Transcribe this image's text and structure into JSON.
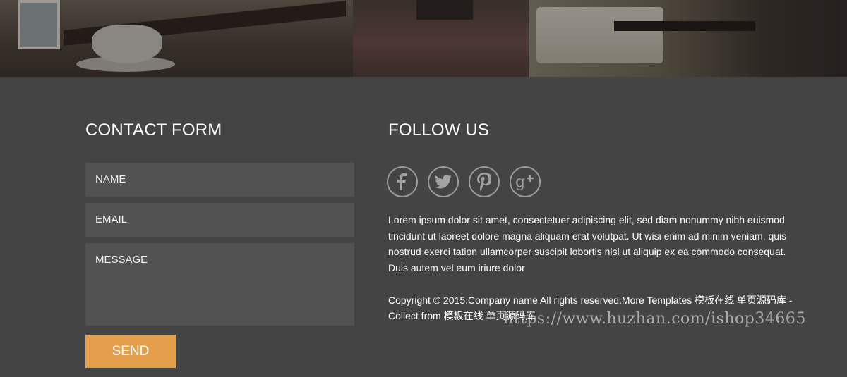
{
  "contact_form": {
    "title": "CONTACT FORM",
    "name_placeholder": "NAME",
    "email_placeholder": "EMAIL",
    "message_placeholder": "MESSAGE",
    "send_label": "SEND"
  },
  "follow": {
    "title": "FOLLOW US",
    "icons": [
      "facebook-icon",
      "twitter-icon",
      "pinterest-icon",
      "google-plus-icon"
    ],
    "description": "Lorem ipsum dolor sit amet, consectetuer adipiscing elit, sed diam nonummy nibh euismod tincidunt ut laoreet dolore magna aliquam erat volutpat. Ut wisi enim ad minim veniam, quis nostrud exerci tation ullamcorper suscipit lobortis nisl ut aliquip ex ea commodo consequat. Duis autem vel eum iriure dolor",
    "copyright": "Copyright © 2015.Company name All rights reserved.More Templates 模板在线 单页源码库 - Collect from 模板在线 单页源码库"
  },
  "watermark": "https://www.huzhan.com/ishop34665",
  "colors": {
    "background": "#444444",
    "field": "#525252",
    "send_button": "#e49e4c",
    "icon_ring": "#9c9c9c"
  }
}
